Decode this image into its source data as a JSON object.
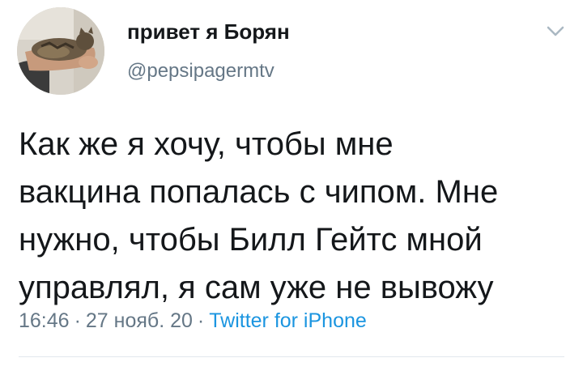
{
  "tweet": {
    "author": {
      "display_name": "привет я Борян",
      "handle": "@pepsipagermtv"
    },
    "text_lines": [
      "Как же я хочу, чтобы мне",
      "вакцина попалась с чипом. Мне",
      "нужно, чтобы Билл Гейтс мной",
      "управлял, я сам уже не вывожу"
    ],
    "time": "16:46",
    "separator": "·",
    "date": "27 нояб. 20",
    "source": "Twitter for iPhone",
    "menu_icon": "chevron-down-icon"
  },
  "colors": {
    "text": "#14171a",
    "secondary": "#657786",
    "link": "#1b95e0",
    "divider": "#e1e8ed"
  }
}
